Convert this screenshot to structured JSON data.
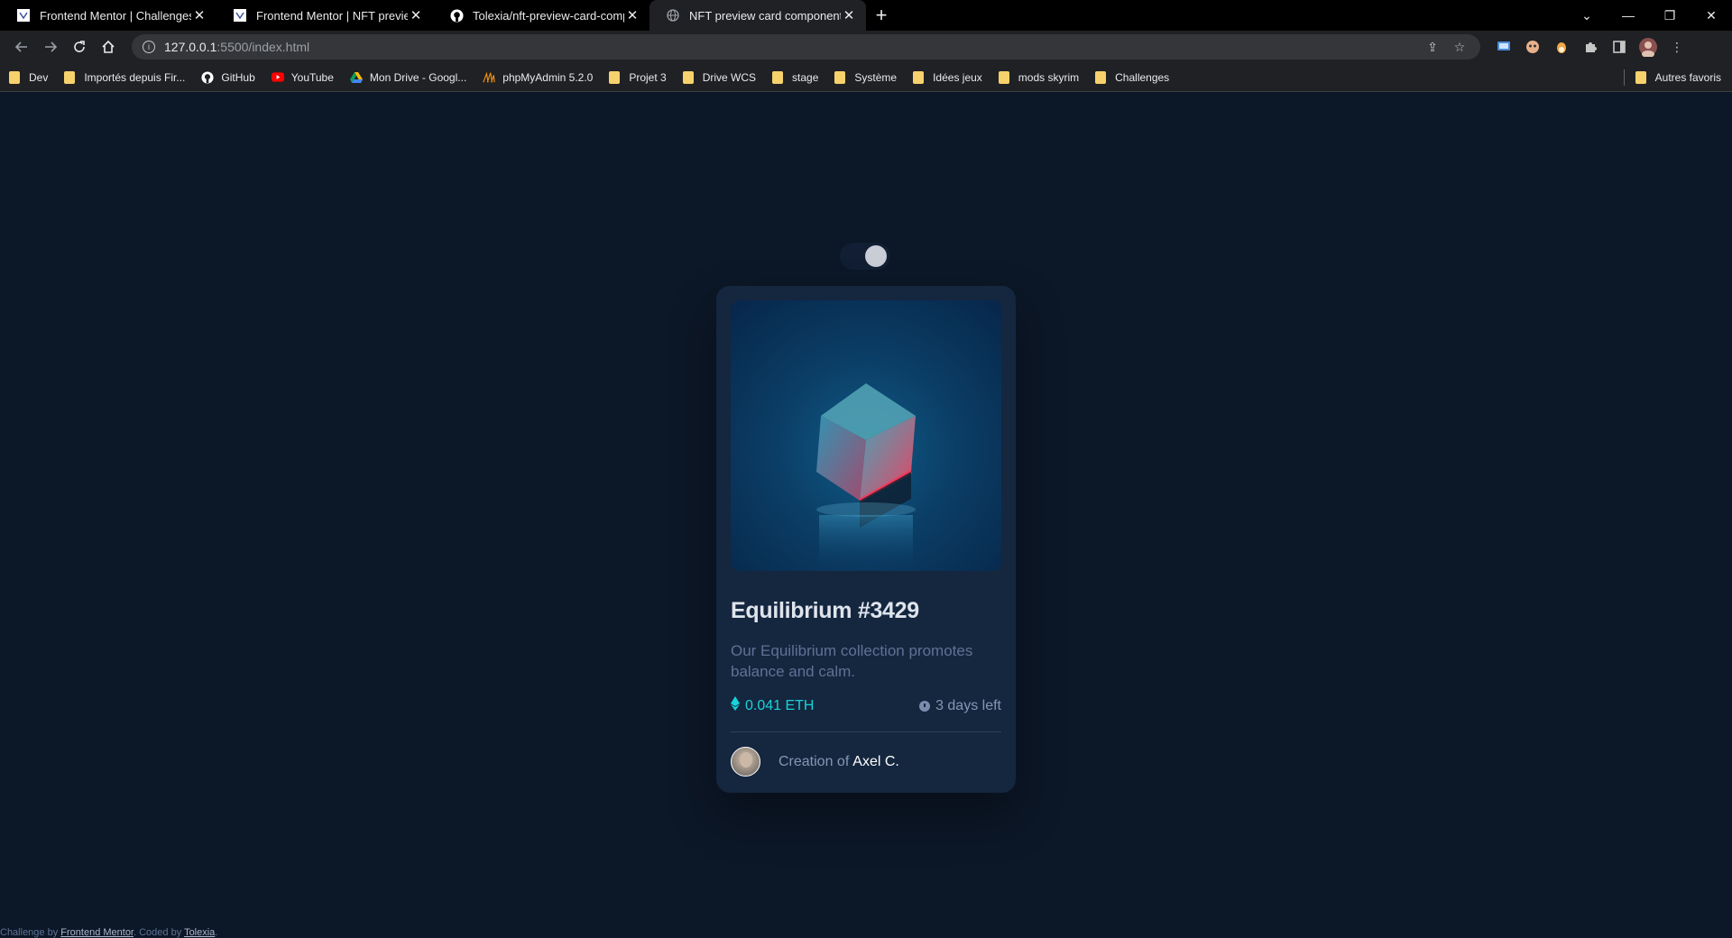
{
  "browser": {
    "tabs": [
      {
        "title": "Frontend Mentor | Challenges",
        "active": false,
        "icon": "frontend-mentor-icon"
      },
      {
        "title": "Frontend Mentor | NFT preview c",
        "active": false,
        "icon": "frontend-mentor-icon"
      },
      {
        "title": "Tolexia/nft-preview-card-compo",
        "active": false,
        "icon": "github-icon"
      },
      {
        "title": "NFT preview card component",
        "active": true,
        "icon": "globe-icon"
      }
    ],
    "new_tab": "+",
    "window": {
      "minimize": "—",
      "restore": "❐",
      "close": "✕",
      "tabsearch": "⌄"
    },
    "address": {
      "host": "127.0.0.1",
      "rest": ":5500/index.html"
    }
  },
  "bookmarks": {
    "items": [
      {
        "label": "Dev",
        "icon": "folder"
      },
      {
        "label": "Importés depuis Fir...",
        "icon": "folder"
      },
      {
        "label": "GitHub",
        "icon": "github"
      },
      {
        "label": "YouTube",
        "icon": "youtube"
      },
      {
        "label": "Mon Drive - Googl...",
        "icon": "drive"
      },
      {
        "label": "phpMyAdmin 5.2.0",
        "icon": "phpmyadmin"
      },
      {
        "label": "Projet 3",
        "icon": "folder"
      },
      {
        "label": "Drive WCS",
        "icon": "folder"
      },
      {
        "label": "stage",
        "icon": "folder"
      },
      {
        "label": "Système",
        "icon": "folder"
      },
      {
        "label": "Idées jeux",
        "icon": "folder"
      },
      {
        "label": "mods skyrim",
        "icon": "folder"
      },
      {
        "label": "Challenges",
        "icon": "folder"
      }
    ],
    "other": "Autres favoris"
  },
  "card": {
    "title": "Equilibrium #3429",
    "description": "Our Equilibrium collection promotes balance and calm.",
    "price": "0.041 ETH",
    "time_left": "3 days left",
    "creation_prefix": "Creation of",
    "creator": "Axel C."
  },
  "attribution": {
    "prefix": "Challenge by",
    "link1": "Frontend Mentor",
    "middle": ". Coded by",
    "link2": "Tolexia",
    "suffix": "."
  },
  "colors": {
    "page_bg": "#0c1727",
    "card_bg": "#15263f",
    "accent_cyan": "#19d3d8",
    "soft_blue": "#8397b5"
  }
}
